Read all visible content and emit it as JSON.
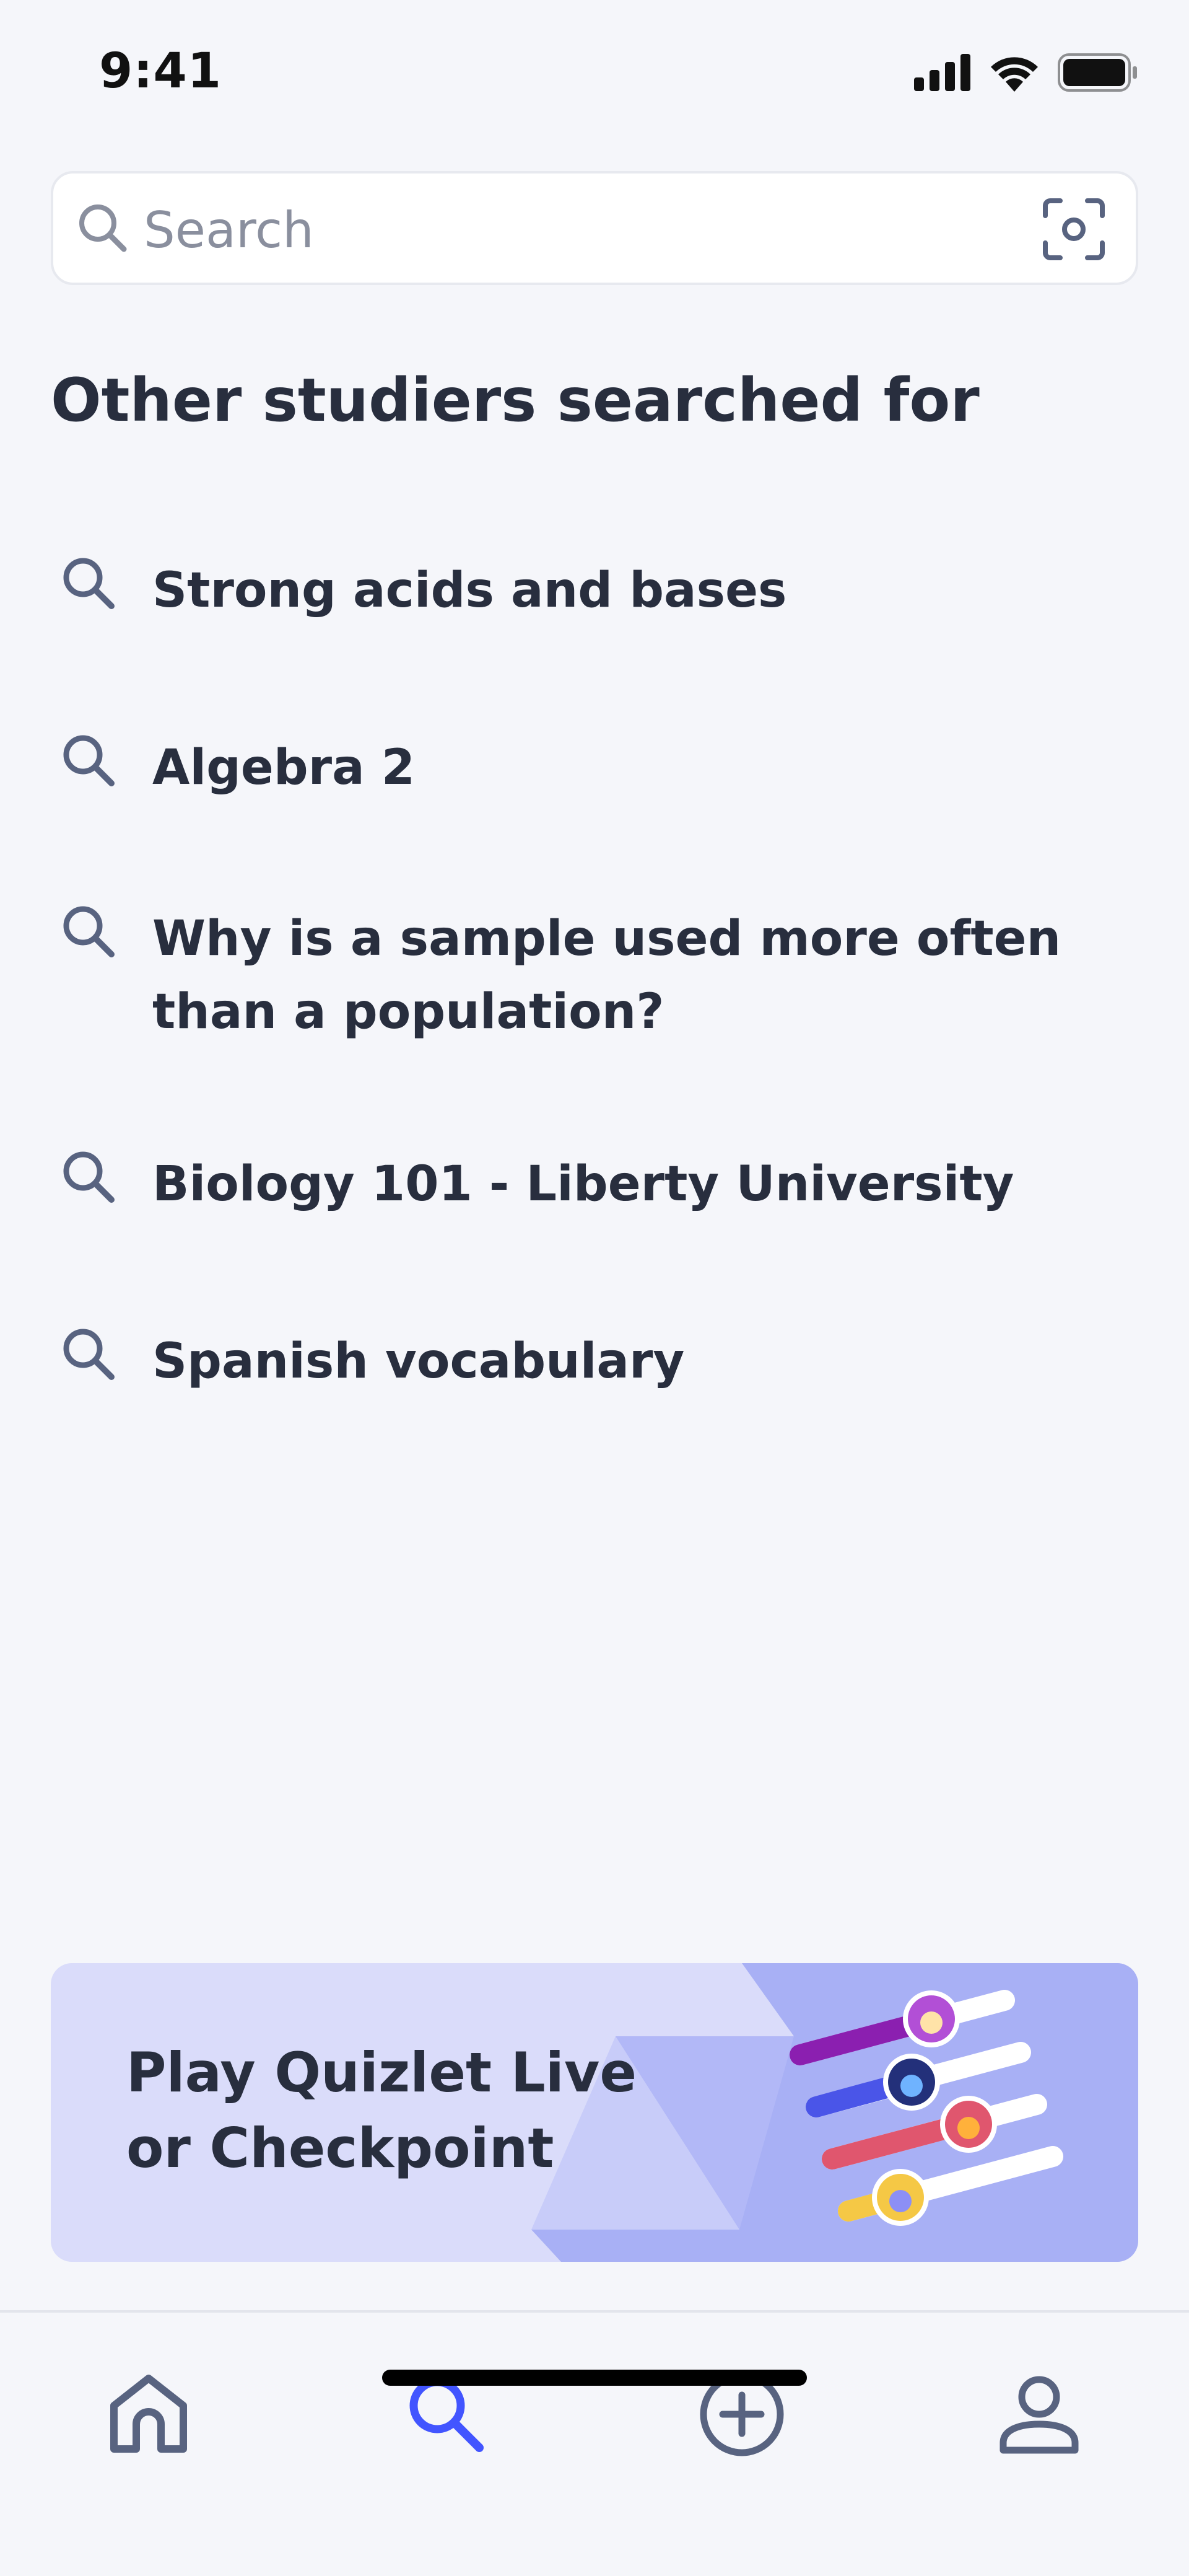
{
  "status_bar": {
    "time": "9:41",
    "icons": [
      "cellular-signal-icon",
      "wifi-icon",
      "battery-icon"
    ]
  },
  "search": {
    "placeholder": "Search",
    "value": "",
    "icons": [
      "search-icon",
      "scan-icon"
    ]
  },
  "suggestions": {
    "heading": "Other studiers searched for",
    "items": [
      {
        "label": "Strong acids and bases"
      },
      {
        "label": "Algebra 2"
      },
      {
        "label": "Why is a sample used more often than a population?"
      },
      {
        "label": "Biology 101 - Liberty University"
      },
      {
        "label": "Spanish vocabulary"
      }
    ]
  },
  "promo": {
    "title_line1": "Play Quizlet Live",
    "title_line2": "or Checkpoint",
    "bar_colors": [
      "#8b1fb0",
      "#4a55e8",
      "#e0566e",
      "#f5c845"
    ]
  },
  "bottom_nav": {
    "items": [
      {
        "name": "home",
        "icon": "home-icon",
        "active": false
      },
      {
        "name": "search",
        "icon": "search-icon",
        "active": true
      },
      {
        "name": "create",
        "icon": "plus-circle-icon",
        "active": false
      },
      {
        "name": "profile",
        "icon": "profile-icon",
        "active": false
      }
    ]
  },
  "colors": {
    "background": "#f5f6fa",
    "text": "#282e3e",
    "icon": "#586380",
    "accent": "#4255ff",
    "promo_bg": "#dadcfa",
    "promo_shape": "#a8b0f5"
  }
}
